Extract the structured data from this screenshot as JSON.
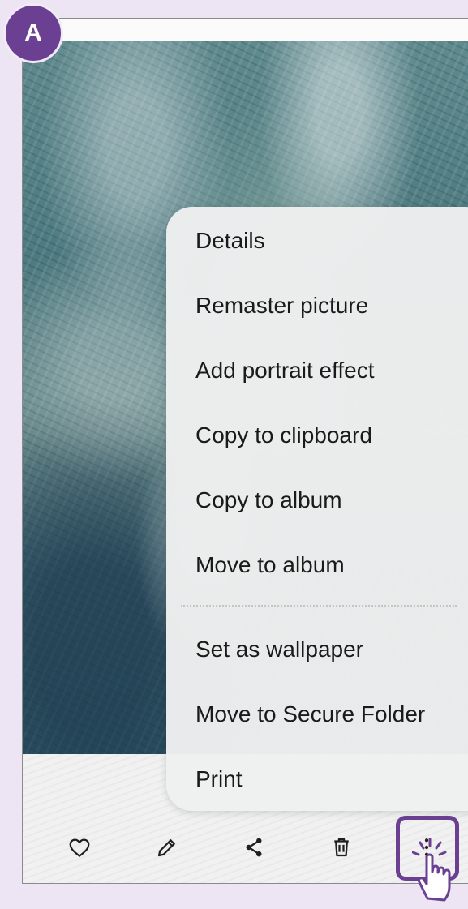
{
  "step_badge": "A",
  "menu": {
    "items": [
      "Details",
      "Remaster picture",
      "Add portrait effect",
      "Copy to clipboard",
      "Copy to album",
      "Move to album",
      "Set as wallpaper",
      "Move to Secure Folder",
      "Print"
    ]
  },
  "toolbar": {
    "icons": [
      "heart-icon",
      "edit-pencil-icon",
      "share-icon",
      "trash-icon",
      "more-options-icon"
    ]
  },
  "colors": {
    "accent": "#6b3f91",
    "page_bg": "#ede5f3",
    "menu_bg": "#eef0f0"
  }
}
